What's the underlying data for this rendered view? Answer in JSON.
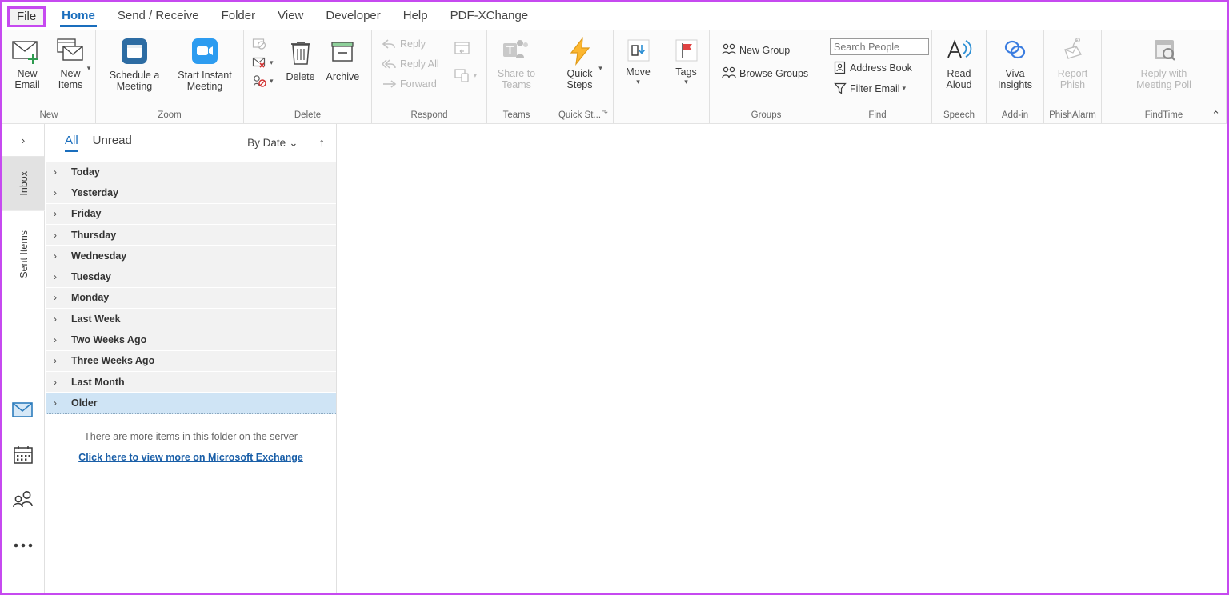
{
  "window": {
    "accent_border_color": "#c64af0"
  },
  "tabs": [
    {
      "label": "File",
      "name": "tab-file",
      "style": "file",
      "active": false
    },
    {
      "label": "Home",
      "name": "tab-home",
      "style": "normal",
      "active": true
    },
    {
      "label": "Send / Receive",
      "name": "tab-send-receive",
      "style": "normal",
      "active": false
    },
    {
      "label": "Folder",
      "name": "tab-folder",
      "style": "normal",
      "active": false
    },
    {
      "label": "View",
      "name": "tab-view",
      "style": "normal",
      "active": false
    },
    {
      "label": "Developer",
      "name": "tab-developer",
      "style": "normal",
      "active": false
    },
    {
      "label": "Help",
      "name": "tab-help",
      "style": "normal",
      "active": false
    },
    {
      "label": "PDF-XChange",
      "name": "tab-pdf-xchange",
      "style": "normal",
      "active": false
    }
  ],
  "ribbon": {
    "collapse_icon": "⌃",
    "groups": {
      "new": {
        "label": "New",
        "new_email": "New\nEmail",
        "new_items": "New\nItems"
      },
      "zoom": {
        "label": "Zoom",
        "schedule_meeting": "Schedule a\nMeeting",
        "start_instant_meeting": "Start Instant\nMeeting"
      },
      "delete": {
        "label": "Delete",
        "delete_button": "Delete",
        "archive_button": "Archive"
      },
      "respond": {
        "label": "Respond",
        "reply": "Reply",
        "reply_all": "Reply All",
        "forward": "Forward"
      },
      "teams": {
        "label": "Teams",
        "share_to_teams": "Share to\nTeams"
      },
      "quick_steps": {
        "label": "Quick St...",
        "quick_steps": "Quick\nSteps",
        "launcher_icon": "⬎"
      },
      "move": {
        "label": "",
        "move": "Move"
      },
      "tags": {
        "label": "",
        "tags": "Tags"
      },
      "groups": {
        "label": "Groups",
        "new_group": "New Group",
        "browse_groups": "Browse Groups"
      },
      "find": {
        "label": "Find",
        "search_people_placeholder": "Search People",
        "search_people_value": "",
        "address_book": "Address Book",
        "filter_email": "Filter Email"
      },
      "speech": {
        "label": "Speech",
        "read_aloud": "Read\nAloud"
      },
      "addin": {
        "label": "Add-in",
        "viva_insights": "Viva\nInsights"
      },
      "phishalarm": {
        "label": "PhishAlarm",
        "report_phish": "Report\nPhish"
      },
      "findtime": {
        "label": "FindTime",
        "reply_with_meeting_poll": "Reply with\nMeeting Poll"
      }
    }
  },
  "rail": {
    "expand_icon": "›",
    "folders": [
      {
        "label": "Inbox",
        "selected": true
      },
      {
        "label": "Sent Items",
        "selected": false
      }
    ],
    "nav": [
      {
        "name": "mail-icon",
        "selected": true
      },
      {
        "name": "calendar-icon",
        "selected": false
      },
      {
        "name": "people-icon",
        "selected": false
      },
      {
        "name": "more-nav-icon",
        "selected": false
      }
    ]
  },
  "message_list": {
    "filters": [
      {
        "label": "All",
        "active": true
      },
      {
        "label": "Unread",
        "active": false
      }
    ],
    "sort_by": "By Date",
    "sort_chevron": "⌄",
    "sort_direction_icon": "↑",
    "groups": [
      {
        "label": "Today",
        "selected": false
      },
      {
        "label": "Yesterday",
        "selected": false
      },
      {
        "label": "Friday",
        "selected": false
      },
      {
        "label": "Thursday",
        "selected": false
      },
      {
        "label": "Wednesday",
        "selected": false
      },
      {
        "label": "Tuesday",
        "selected": false
      },
      {
        "label": "Monday",
        "selected": false
      },
      {
        "label": "Last Week",
        "selected": false
      },
      {
        "label": "Two Weeks Ago",
        "selected": false
      },
      {
        "label": "Three Weeks Ago",
        "selected": false
      },
      {
        "label": "Last Month",
        "selected": false
      },
      {
        "label": "Older",
        "selected": true
      }
    ],
    "group_chevron": "›",
    "more_items_note": "There are more items in this folder on the server",
    "more_items_link": "Click here to view more on Microsoft Exchange"
  }
}
